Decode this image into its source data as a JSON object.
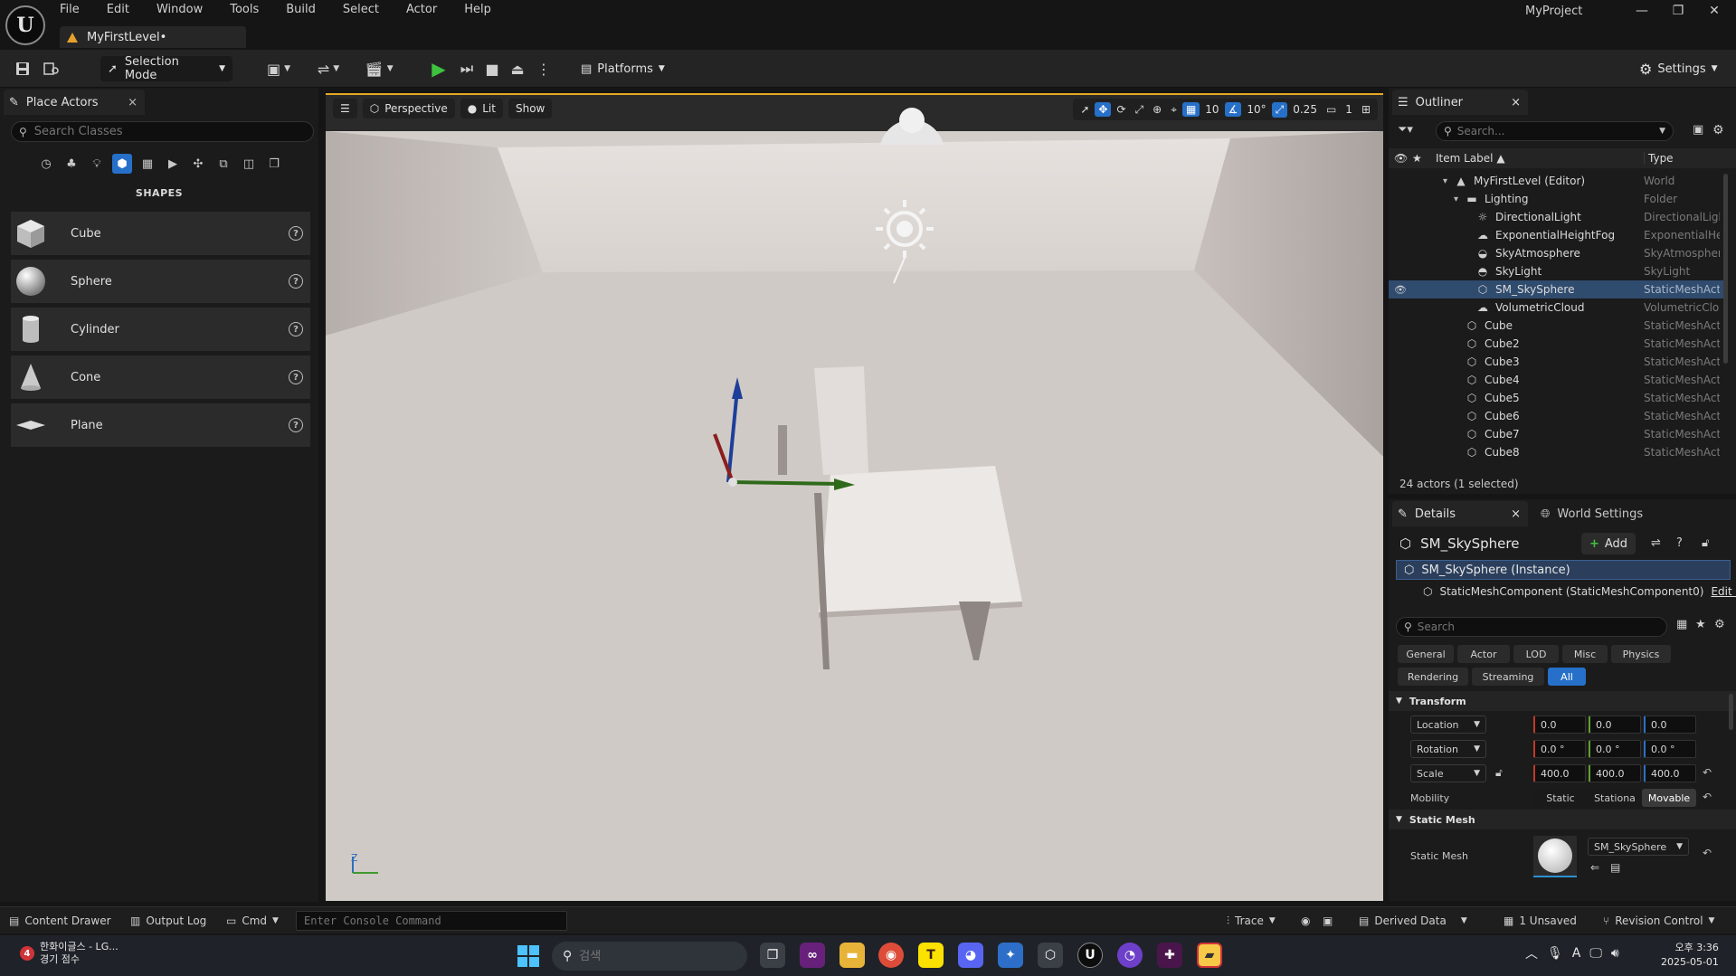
{
  "app": {
    "menu": [
      "File",
      "Edit",
      "Window",
      "Tools",
      "Build",
      "Select",
      "Actor",
      "Help"
    ],
    "level_tab": "MyFirstLevel•",
    "project_name": "MyProject",
    "window_controls": [
      "—",
      "❐",
      "✕"
    ]
  },
  "toolbar": {
    "selection_mode": "Selection Mode",
    "platforms": "Platforms",
    "settings": "Settings"
  },
  "place_actors": {
    "tab_label": "Place Actors",
    "close": "×",
    "search_placeholder": "Search Classes",
    "section": "SHAPES",
    "items": [
      {
        "label": "Cube",
        "help": "?"
      },
      {
        "label": "Sphere",
        "help": "?"
      },
      {
        "label": "Cylinder",
        "help": "?"
      },
      {
        "label": "Cone",
        "help": "?"
      },
      {
        "label": "Plane",
        "help": "?"
      }
    ]
  },
  "viewport": {
    "menu_icon": "☰",
    "perspective": "Perspective",
    "lit": "Lit",
    "show": "Show",
    "grid_snap": "10",
    "rot_snap": "10°",
    "scale_snap": "0.25",
    "camera_speed": "1",
    "axis_z": "Z"
  },
  "outliner": {
    "tab_label": "Outliner",
    "close": "×",
    "search_placeholder": "Search...",
    "col_label": "Item Label ▲",
    "col_type": "Type",
    "rows": [
      {
        "label": "MyFirstLevel (Editor)",
        "type": "World",
        "indent": 0,
        "icon": "▲",
        "expand": "▾"
      },
      {
        "label": "Lighting",
        "type": "Folder",
        "indent": 1,
        "icon": "▬",
        "expand": "▾"
      },
      {
        "label": "DirectionalLight",
        "type": "DirectionalLight",
        "indent": 2,
        "icon": "☼",
        "expand": ""
      },
      {
        "label": "ExponentialHeightFog",
        "type": "ExponentialHeightFog",
        "indent": 2,
        "icon": "☁",
        "expand": ""
      },
      {
        "label": "SkyAtmosphere",
        "type": "SkyAtmosphere",
        "indent": 2,
        "icon": "◒",
        "expand": ""
      },
      {
        "label": "SkyLight",
        "type": "SkyLight",
        "indent": 2,
        "icon": "◓",
        "expand": ""
      },
      {
        "label": "SM_SkySphere",
        "type": "StaticMeshActor",
        "indent": 2,
        "icon": "⬡",
        "expand": "",
        "selected": true
      },
      {
        "label": "VolumetricCloud",
        "type": "VolumetricCloud",
        "indent": 2,
        "icon": "☁",
        "expand": ""
      },
      {
        "label": "Cube",
        "type": "StaticMeshActor",
        "indent": 1,
        "icon": "⬡",
        "expand": ""
      },
      {
        "label": "Cube2",
        "type": "StaticMeshActor",
        "indent": 1,
        "icon": "⬡",
        "expand": ""
      },
      {
        "label": "Cube3",
        "type": "StaticMeshActor",
        "indent": 1,
        "icon": "⬡",
        "expand": ""
      },
      {
        "label": "Cube4",
        "type": "StaticMeshActor",
        "indent": 1,
        "icon": "⬡",
        "expand": ""
      },
      {
        "label": "Cube5",
        "type": "StaticMeshActor",
        "indent": 1,
        "icon": "⬡",
        "expand": ""
      },
      {
        "label": "Cube6",
        "type": "StaticMeshActor",
        "indent": 1,
        "icon": "⬡",
        "expand": ""
      },
      {
        "label": "Cube7",
        "type": "StaticMeshActor",
        "indent": 1,
        "icon": "⬡",
        "expand": ""
      },
      {
        "label": "Cube8",
        "type": "StaticMeshActor",
        "indent": 1,
        "icon": "⬡",
        "expand": ""
      }
    ],
    "actor_count": "24 actors (1 selected)"
  },
  "details": {
    "tab_label": "Details",
    "close": "×",
    "world_settings": "World Settings",
    "title": "SM_SkySphere",
    "add": "Add",
    "instance": "SM_SkySphere (Instance)",
    "component": "StaticMeshComponent (StaticMeshComponent0)",
    "edit_link": "Edit i",
    "search_placeholder": "Search",
    "filters_row1": [
      "General",
      "Actor",
      "LOD",
      "Misc",
      "Physics"
    ],
    "filters_row2": [
      "Rendering",
      "Streaming",
      "All"
    ],
    "transform_header": "Transform",
    "location": {
      "label": "Location",
      "x": "0.0",
      "y": "0.0",
      "z": "0.0"
    },
    "rotation": {
      "label": "Rotation",
      "x": "0.0 °",
      "y": "0.0 °",
      "z": "0.0 °"
    },
    "scale": {
      "label": "Scale",
      "x": "400.0",
      "y": "400.0",
      "z": "400.0"
    },
    "mobility": {
      "label": "Mobility",
      "options": [
        "Static",
        "Stationa",
        "Movable"
      ],
      "selected": "Movable"
    },
    "static_mesh_header": "Static Mesh",
    "static_mesh_label": "Static Mesh",
    "static_mesh_value": "SM_SkySphere"
  },
  "statusbar": {
    "content_drawer": "Content Drawer",
    "output_log": "Output Log",
    "cmd": "Cmd",
    "console_placeholder": "Enter Console Command",
    "trace": "Trace",
    "derived_data": "Derived Data",
    "unsaved": "1 Unsaved",
    "revision_control": "Revision Control"
  },
  "taskbar": {
    "news_title": "한화이글스 - LG...",
    "news_sub": "경기 점수",
    "news_badge": "4",
    "search_placeholder": "검색",
    "time": "오후 3:36",
    "date": "2025-05-01"
  },
  "colors": {
    "accent": "#2670c9",
    "selection": "#2f4b6e",
    "play": "#3fc23f",
    "viewport_border": "#e6a823"
  }
}
